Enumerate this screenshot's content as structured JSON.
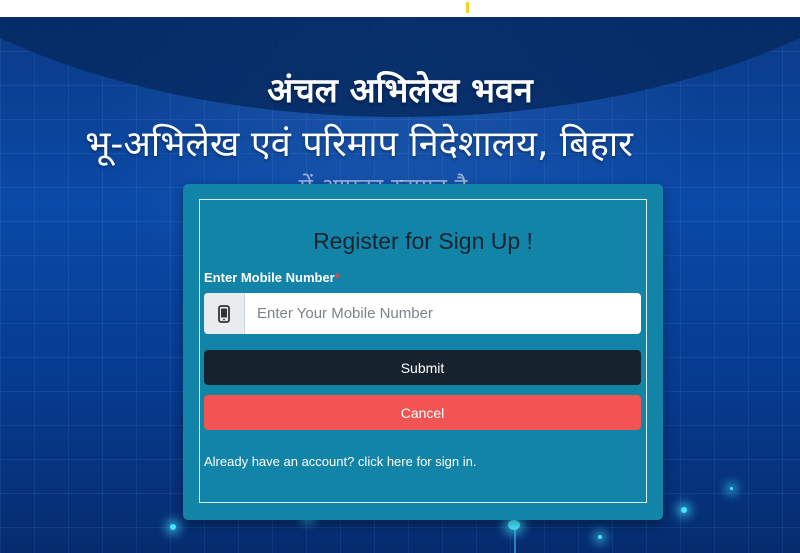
{
  "header": {
    "title_line1": "अंचल अभिलेख भवन",
    "title_line2": "भू-अभिलेख एवं परिमाप निदेशालय, बिहार",
    "title_line3": "में आपका स्वागत है"
  },
  "form": {
    "heading": "Register for Sign Up !",
    "mobile_label": "Enter Mobile Number",
    "required_mark": "*",
    "mobile_placeholder": "Enter Your Mobile Number",
    "mobile_value": "",
    "submit_label": "Submit",
    "cancel_label": "Cancel",
    "signin_text": "Already have an account? click here for sign in."
  },
  "icons": {
    "input_addon": "mobile-phone-icon"
  },
  "colors": {
    "card": "#1184a8",
    "submit": "#16232e",
    "cancel": "#f25353",
    "background": "#0a4aa8"
  }
}
